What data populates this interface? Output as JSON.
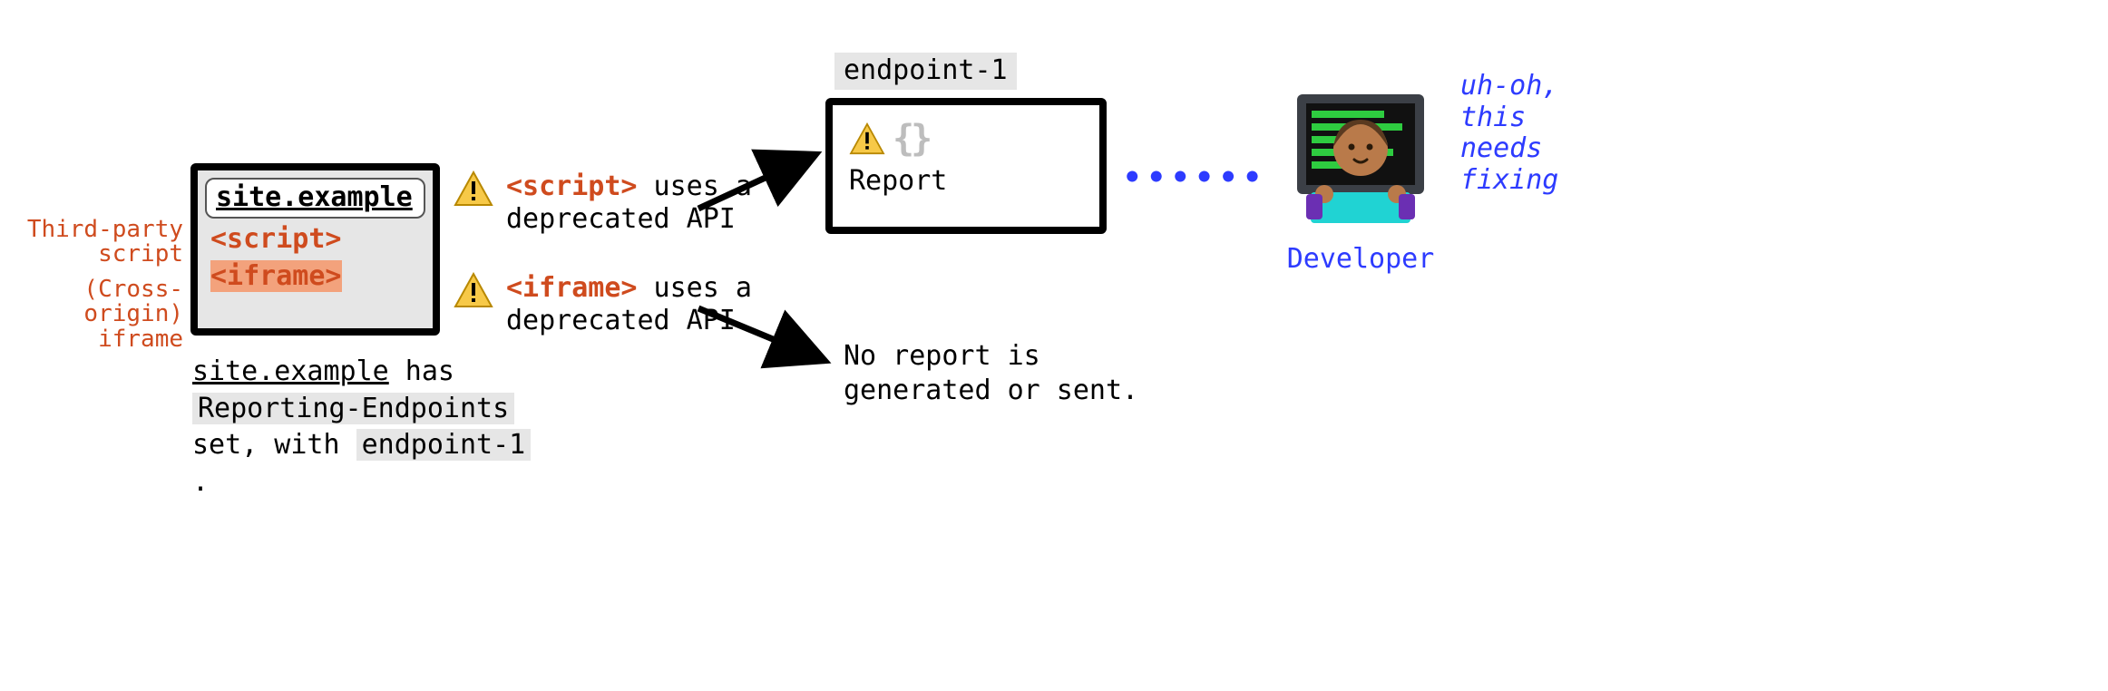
{
  "browser": {
    "url": "site.example",
    "script_tag": "<script>",
    "iframe_tag": "<iframe>"
  },
  "side_labels": {
    "script": "Third-party\nscript",
    "iframe": "(Cross-origin)\niframe"
  },
  "caption": {
    "site": "site.example",
    "has": " has ",
    "header": "Reporting-Endpoints",
    "set_with": "set, with ",
    "endpoint": "endpoint-1",
    "period": " ."
  },
  "warnings": {
    "script": {
      "code": "<script>",
      "rest": " uses a deprecated API"
    },
    "iframe": {
      "code": "<iframe>",
      "rest": " uses a deprecated API"
    }
  },
  "endpoint": {
    "label": "endpoint-1",
    "braces": "{}",
    "report": "Report"
  },
  "no_report": "No report is generated or sent.",
  "connector_dots": "••••••",
  "developer": {
    "label": "Developer",
    "quote": "uh-oh, this needs fixing"
  }
}
